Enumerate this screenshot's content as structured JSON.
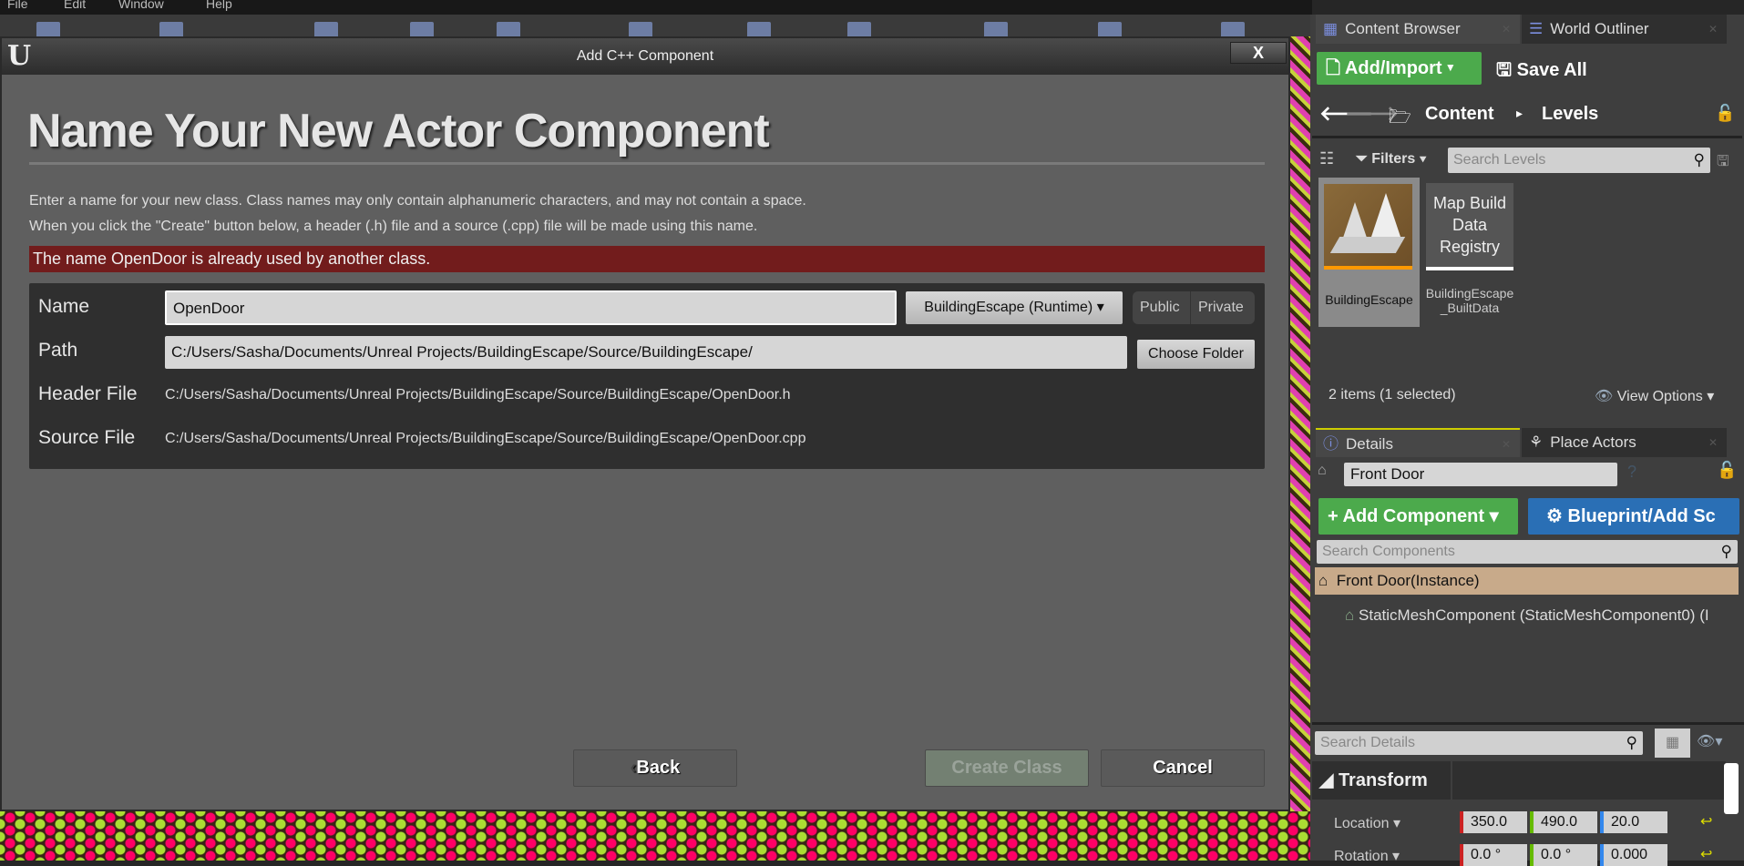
{
  "menu": [
    "File",
    "Edit",
    "Window",
    "Help"
  ],
  "dialog": {
    "title": "Add C++ Component",
    "close": "X",
    "heading": "Name Your New Actor Component",
    "desc1": "Enter a name for your new class. Class names may only contain alphanumeric characters, and may not contain a space.",
    "desc2": "When you click the \"Create\" button below, a header (.h) file and a source (.cpp) file will be made using this name.",
    "error": "The name OpenDoor is already used by another class.",
    "name_label": "Name",
    "name_value": "OpenDoor",
    "module": "BuildingEscape (Runtime)",
    "public": "Public",
    "private": "Private",
    "path_label": "Path",
    "path_value": "C:/Users/Sasha/Documents/Unreal Projects/BuildingEscape/Source/BuildingEscape/",
    "choose_folder": "Choose Folder",
    "header_label": "Header File",
    "header_value": "C:/Users/Sasha/Documents/Unreal Projects/BuildingEscape/Source/BuildingEscape/OpenDoor.h",
    "source_label": "Source File",
    "source_value": "C:/Users/Sasha/Documents/Unreal Projects/BuildingEscape/Source/BuildingEscape/OpenDoor.cpp",
    "back": "Back",
    "create": "Create Class",
    "cancel": "Cancel",
    "error_color": "#721c1c"
  },
  "content_browser": {
    "tab": "Content Browser",
    "tab2": "World Outliner",
    "add_import": "Add/Import",
    "save_all": "Save All",
    "crumbs": [
      "Content",
      "Levels"
    ],
    "filters": "Filters",
    "search_placeholder": "Search Levels",
    "assets": [
      {
        "name": "BuildingEscape",
        "selected": true
      },
      {
        "thumb": "Map Build Data Registry",
        "name": "BuildingEscape _BuiltData"
      }
    ],
    "count": "2 items (1 selected)",
    "view_options": "View Options"
  },
  "details": {
    "tab": "Details",
    "tab2": "Place Actors",
    "actor_name": "Front Door",
    "add_component": "Add Component",
    "blueprint": "Blueprint/Add Sc",
    "search_components": "Search Components",
    "root": "Front Door(Instance)",
    "child": "StaticMeshComponent (StaticMeshComponent0) (I",
    "search_details": "Search Details",
    "section": "Transform",
    "location_label": "Location",
    "location": [
      "350.0",
      "490.0",
      "20.0"
    ],
    "rotation_label": "Rotation",
    "rotation": [
      "0.0 °",
      "0.0 °",
      "0.000"
    ]
  }
}
